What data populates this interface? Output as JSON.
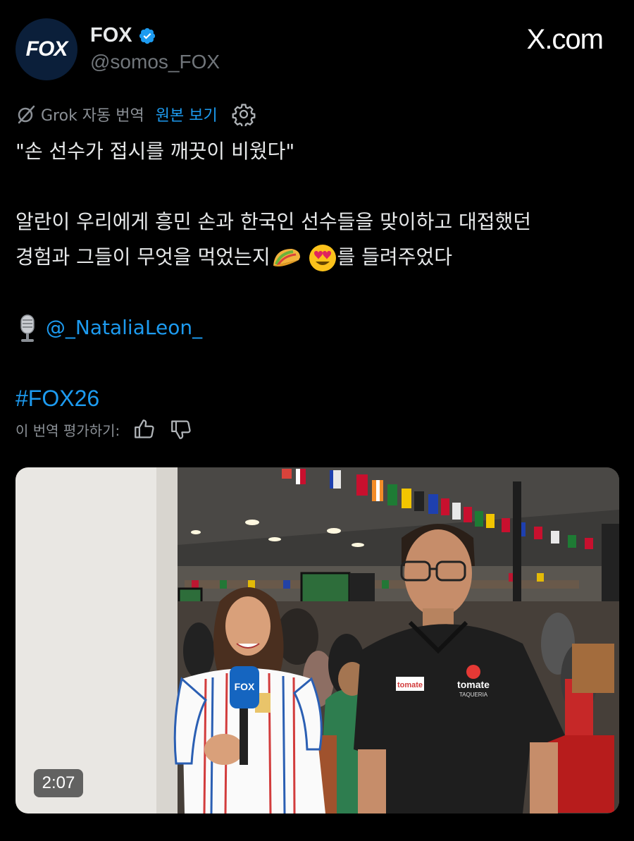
{
  "account": {
    "display_name": "FOX",
    "handle": "@somos_FOX",
    "avatar_text": "FOX",
    "verified": true
  },
  "watermark": "X.com",
  "translation_bar": {
    "label": "Grok 자동 번역",
    "view_original": "원본 보기"
  },
  "tweet": {
    "line1": "\"손 선수가 접시를 깨끗이 비웠다\"",
    "line2": "알란이 우리에게 흥민 손과 한국인 선수들을 맞이하고 대접했던",
    "line3a": "경험과 그들이 무엇을 먹었는지",
    "line3b": "를 들려주었다",
    "mention": "@_NataliaLeon_",
    "hashtag": "#FOX26"
  },
  "rate_translation": {
    "label": "이 번역 평가하기:"
  },
  "video": {
    "duration": "2:07",
    "mic_logo": "FOX",
    "shirt_logo": "tomate",
    "shirt_sub": "TAQUERIA",
    "name_tag": "tomate"
  },
  "colors": {
    "accent": "#1d9bf0",
    "background": "#000000",
    "text": "#e7e9ea",
    "muted": "#71767b"
  },
  "icons": [
    "fox-avatar",
    "verified-badge-icon",
    "grok-icon",
    "settings-gear-icon",
    "taco-emoji",
    "heart-eyes-emoji",
    "microphone-emoji",
    "thumbs-up-icon",
    "thumbs-down-icon"
  ]
}
